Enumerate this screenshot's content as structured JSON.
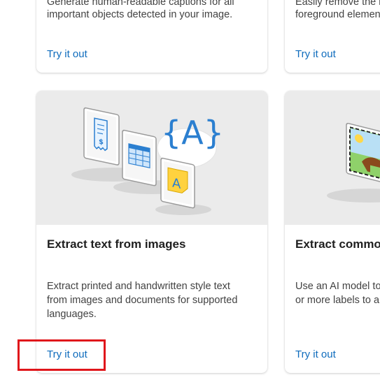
{
  "cards": {
    "top_left": {
      "desc_line1": "Generate human-readable captions for all",
      "desc_line2": "important objects detected in your image.",
      "link": "Try it out"
    },
    "top_right": {
      "desc_line1": "Easily remove the b",
      "desc_line2": "foreground elemen",
      "link": "Try it out"
    },
    "ocr": {
      "title": "Extract text from images",
      "desc_line1": "Extract printed and handwritten style text",
      "desc_line2": "from images and documents for supported",
      "desc_line3": "languages.",
      "link": "Try it out",
      "illustration_glyph": "{A}",
      "note_glyph": "A"
    },
    "labels": {
      "title": "Extract common",
      "desc_line1": "Use an AI model to",
      "desc_line2": "or more labels to a",
      "link": "Try it out"
    }
  },
  "colors": {
    "link": "#0f6cbd",
    "highlight": "#e0161b",
    "thumb_bg": "#ebebeb"
  }
}
